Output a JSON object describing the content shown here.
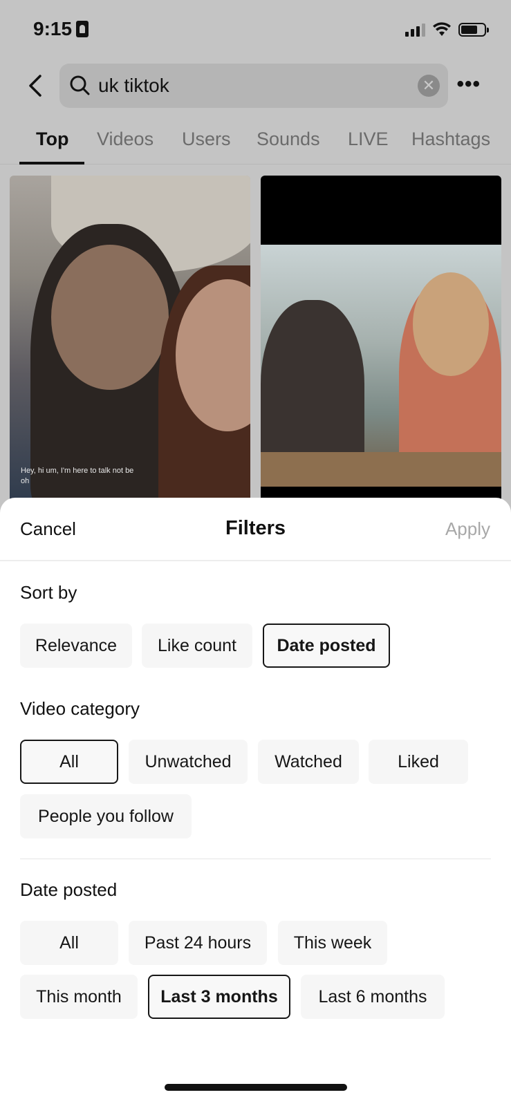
{
  "status_bar": {
    "time": "9:15"
  },
  "search": {
    "query": "uk tiktok"
  },
  "tabs": [
    {
      "label": "Top",
      "active": true
    },
    {
      "label": "Videos"
    },
    {
      "label": "Users"
    },
    {
      "label": "Sounds"
    },
    {
      "label": "LIVE"
    },
    {
      "label": "Hashtags"
    }
  ],
  "results": [
    {
      "caption_line1": "Hey, hi um, I'm here to talk not be",
      "caption_line2": "oh"
    },
    {
      "caption_line1": ""
    }
  ],
  "filters": {
    "cancel_label": "Cancel",
    "title": "Filters",
    "apply_label": "Apply",
    "sort_by": {
      "title": "Sort by",
      "options": [
        "Relevance",
        "Like count",
        "Date posted"
      ],
      "selected": "Date posted"
    },
    "video_category": {
      "title": "Video category",
      "options": [
        "All",
        "Unwatched",
        "Watched",
        "Liked",
        "People you follow"
      ],
      "selected": "All"
    },
    "date_posted": {
      "title": "Date posted",
      "options": [
        "All",
        "Past 24 hours",
        "This week",
        "This month",
        "Last 3 months",
        "Last 6 months"
      ],
      "selected": "Last 3 months"
    }
  }
}
